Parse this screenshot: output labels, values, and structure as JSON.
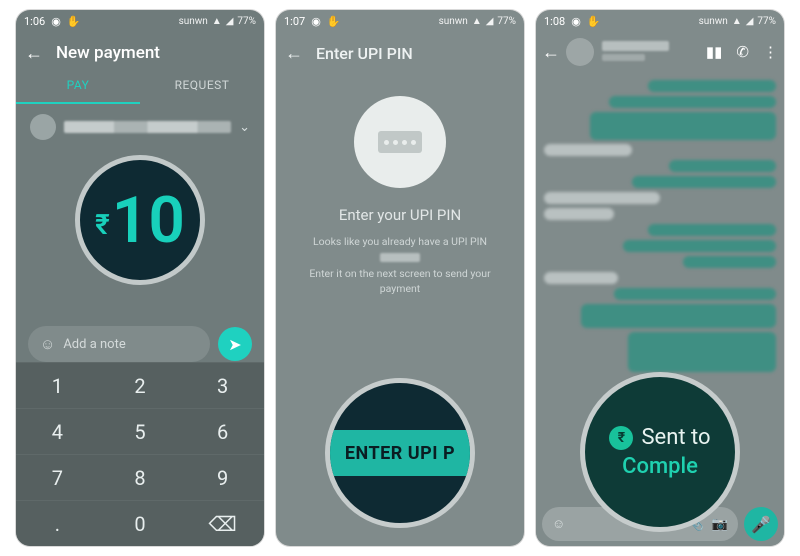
{
  "status": {
    "times": [
      "1:06",
      "1:07",
      "1:08"
    ],
    "battery": "77%",
    "carrier": "sunwn"
  },
  "screen1": {
    "title": "New payment",
    "tabs": {
      "pay": "PAY",
      "request": "REQUEST"
    },
    "amount_display": "10",
    "rupee": "₹",
    "note_placeholder": "Add a note",
    "keypad": [
      "1",
      "2",
      "3",
      "4",
      "5",
      "6",
      "7",
      "8",
      "9",
      ".",
      "0",
      "⌫"
    ]
  },
  "screen2": {
    "title": "Enter UPI PIN",
    "prompt": "Enter your UPI PIN",
    "sub_line1": "Looks like you already have a UPI PIN",
    "sub_line2": "Enter it on the next screen to send your payment",
    "button_label": "ENTER UPI P"
  },
  "screen3": {
    "sent_to_label": "Sent to",
    "status_label": "Comple",
    "rupee": "₹",
    "input_icons": {
      "attach": "📎",
      "camera": "📷"
    }
  }
}
